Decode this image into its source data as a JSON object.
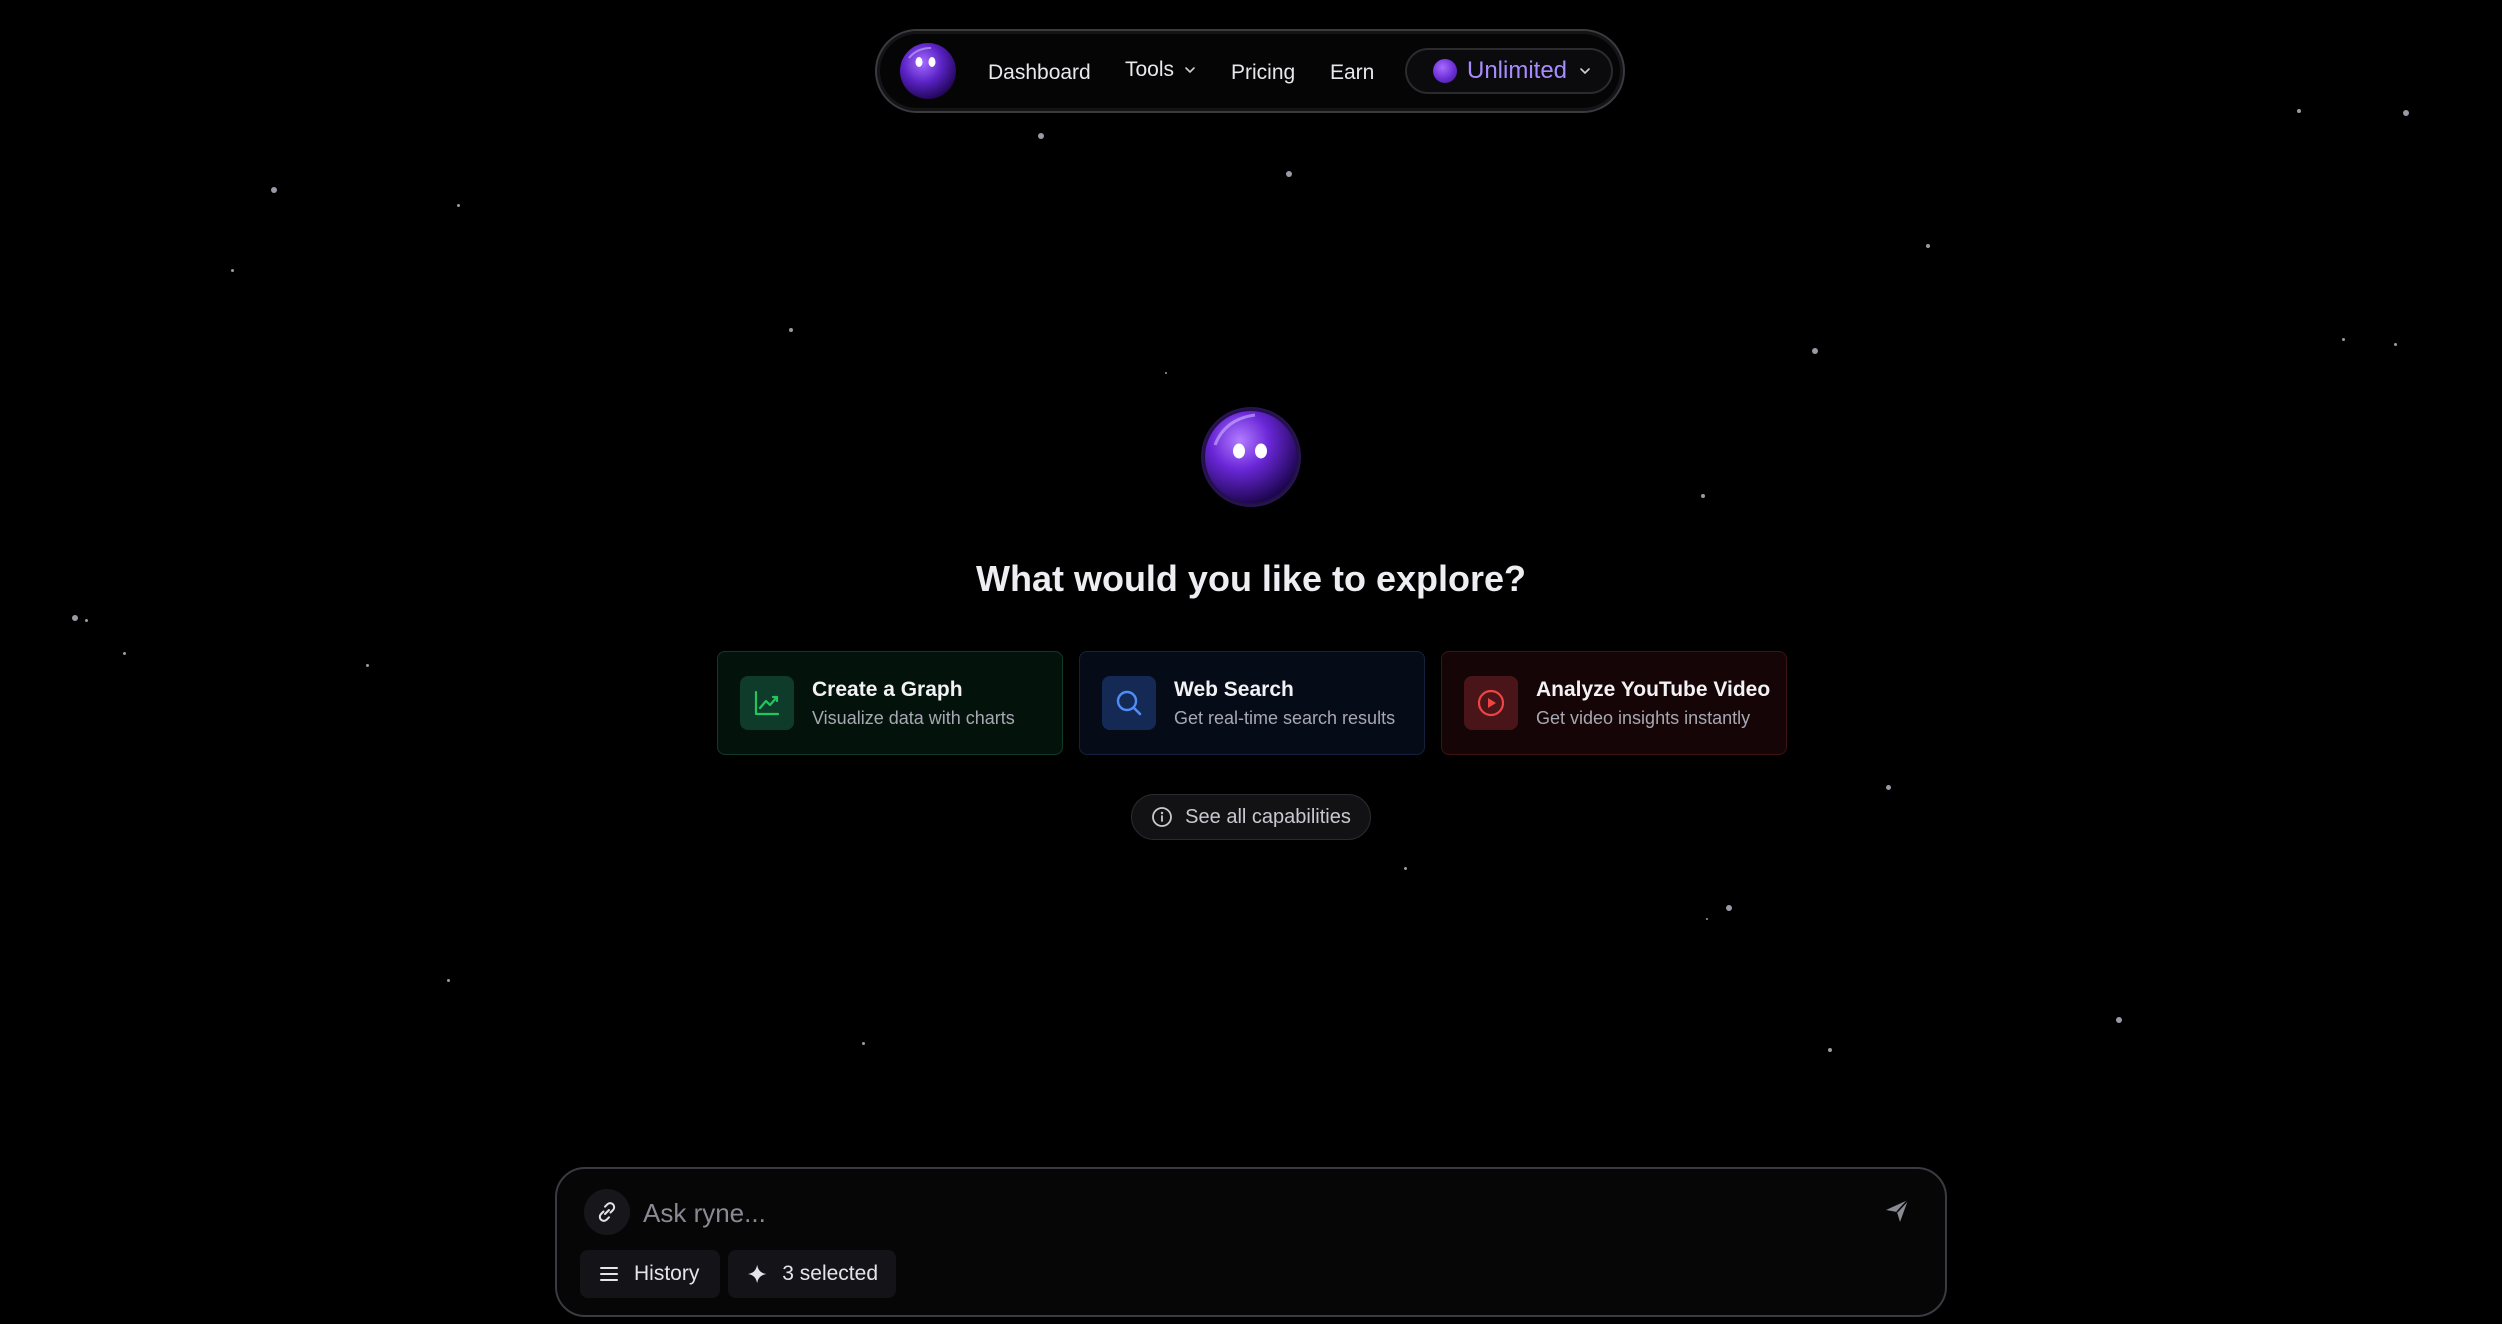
{
  "nav": {
    "links": {
      "dashboard": "Dashboard",
      "tools": "Tools",
      "pricing": "Pricing",
      "earn": "Earn"
    },
    "plan_label": "Unlimited"
  },
  "hero": {
    "title": "What would you like to explore?"
  },
  "cards": [
    {
      "title": "Create a Graph",
      "subtitle": "Visualize data with charts",
      "icon": "chart-trend-icon",
      "accent": "#22c55e"
    },
    {
      "title": "Web Search",
      "subtitle": "Get real-time search results",
      "icon": "search-icon",
      "accent": "#3b82f6"
    },
    {
      "title": "Analyze YouTube Video",
      "subtitle": "Get video insights instantly",
      "icon": "play-circle-icon",
      "accent": "#ef4444"
    }
  ],
  "capabilities": {
    "label": "See all capabilities"
  },
  "composer": {
    "placeholder": "Ask ryne...",
    "value": "",
    "history_label": "History",
    "selected_label": "3 selected"
  },
  "colors": {
    "background": "#000000",
    "accent_purple": "#a88bff"
  }
}
